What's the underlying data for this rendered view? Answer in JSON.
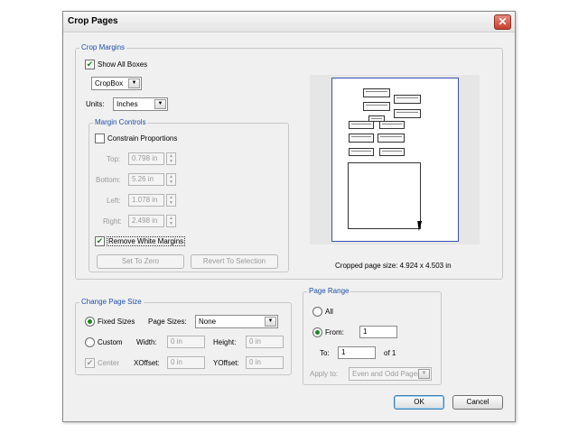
{
  "dialog": {
    "title": "Crop Pages",
    "close_icon": "close-icon"
  },
  "crop_margins": {
    "legend": "Crop Margins",
    "show_all_boxes": {
      "label": "Show All Boxes",
      "checked": true
    },
    "box_select": {
      "value": "CropBox"
    },
    "units": {
      "label": "Units:",
      "value": "Inches"
    },
    "margin_controls": {
      "legend": "Margin Controls",
      "constrain": {
        "label": "Constrain Proportions",
        "checked": false
      },
      "top": {
        "label": "Top:",
        "value": "0.798 in"
      },
      "bottom": {
        "label": "Bottom:",
        "value": "5.26 in"
      },
      "left": {
        "label": "Left:",
        "value": "1.078 in"
      },
      "right": {
        "label": "Right:",
        "value": "2.498 in"
      },
      "remove_white": {
        "label": "Remove White Margins",
        "checked": true
      },
      "set_to_zero": "Set To Zero",
      "revert": "Revert To Selection"
    },
    "cropped_size": "Cropped page size: 4.924 x 4.503 in"
  },
  "change_page_size": {
    "legend": "Change Page Size",
    "fixed_sizes": {
      "label": "Fixed Sizes",
      "selected": true
    },
    "page_sizes_label": "Page Sizes:",
    "page_sizes_value": "None",
    "custom": {
      "label": "Custom",
      "selected": false
    },
    "width": {
      "label": "Width:",
      "value": "0 in"
    },
    "height": {
      "label": "Height:",
      "value": "0 in"
    },
    "center": {
      "label": "Center",
      "checked": true
    },
    "xoffset": {
      "label": "XOffset:",
      "value": "0 in"
    },
    "yoffset": {
      "label": "YOffset:",
      "value": "0 in"
    }
  },
  "page_range": {
    "legend": "Page Range",
    "all": {
      "label": "All",
      "selected": false
    },
    "from": {
      "label": "From:",
      "value": "1",
      "selected": true
    },
    "to": {
      "label": "To:",
      "value": "1"
    },
    "of": "of 1",
    "apply_to": {
      "label": "Apply to:",
      "value": "Even and Odd Pages"
    }
  },
  "buttons": {
    "ok": "OK",
    "cancel": "Cancel"
  }
}
